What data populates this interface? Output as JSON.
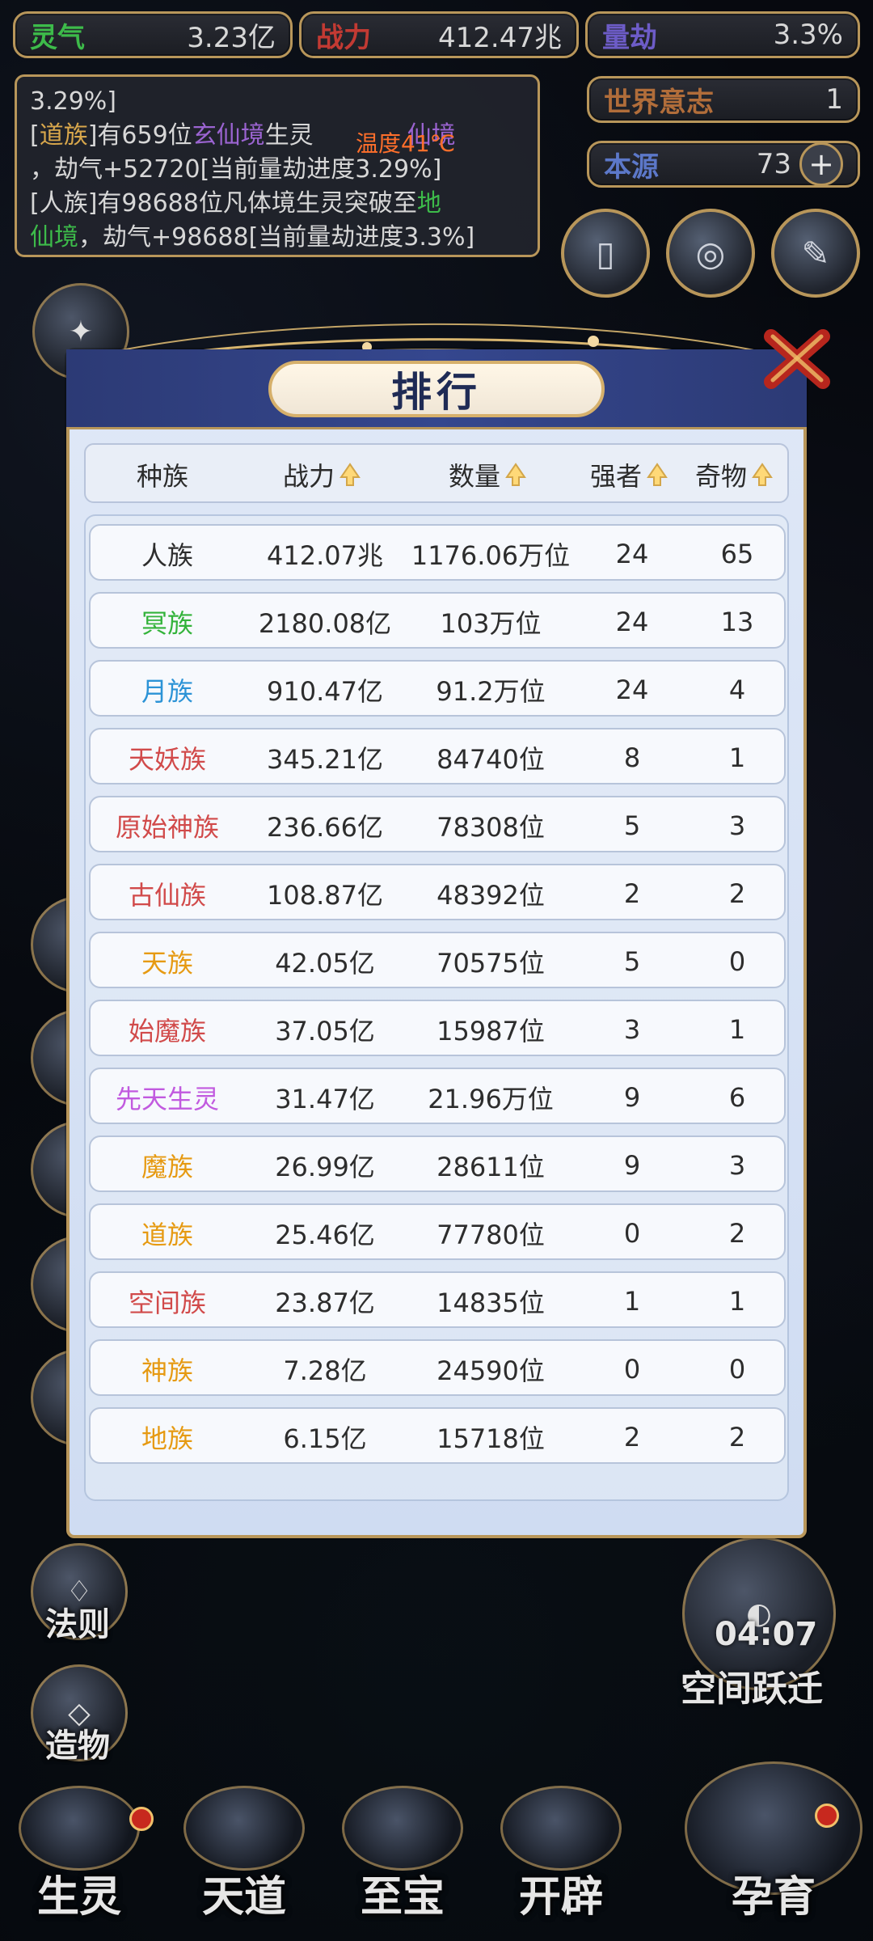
{
  "stats": {
    "lingqi": {
      "label": "灵气",
      "value": "3.23亿"
    },
    "zhanli": {
      "label": "战力",
      "value": "412.47兆"
    },
    "liangjie": {
      "label": "量劫",
      "value": "3.3%"
    },
    "shijie_yizhi": {
      "label": "世界意志",
      "value": "1"
    },
    "benyuan": {
      "label": "本源",
      "value": "73"
    }
  },
  "log": {
    "line1": "3.29%]",
    "line2_prefix": "[",
    "line2_race": "道族",
    "line2_a": "]有659位",
    "line2_realm": "玄仙境",
    "line2_b": "生灵",
    "line2_c": "仙境",
    "line3": "，劫气+52720[当前量劫进度3.29%]",
    "line4_a": "[人族]有98688位凡体境生灵突破至",
    "line4_realm1": "地",
    "line5_realm2": "仙境",
    "line5_b": "，劫气+98688[当前量劫进度3.3%]"
  },
  "temperature": "温度41℃",
  "modal": {
    "title": "排行",
    "headers": [
      "种族",
      "战力",
      "数量",
      "强者",
      "奇物"
    ],
    "rows": [
      {
        "race": "人族",
        "power": "412.07兆",
        "count": "1176.06万位",
        "strong": "24",
        "treasure": "65",
        "color": "#2d2d2d"
      },
      {
        "race": "冥族",
        "power": "2180.08亿",
        "count": "103万位",
        "strong": "24",
        "treasure": "13",
        "color": "#33b33a"
      },
      {
        "race": "月族",
        "power": "910.47亿",
        "count": "91.2万位",
        "strong": "24",
        "treasure": "4",
        "color": "#2c93d6"
      },
      {
        "race": "天妖族",
        "power": "345.21亿",
        "count": "84740位",
        "strong": "8",
        "treasure": "1",
        "color": "#d14a4a"
      },
      {
        "race": "原始神族",
        "power": "236.66亿",
        "count": "78308位",
        "strong": "5",
        "treasure": "3",
        "color": "#d14a4a"
      },
      {
        "race": "古仙族",
        "power": "108.87亿",
        "count": "48392位",
        "strong": "2",
        "treasure": "2",
        "color": "#d14a4a"
      },
      {
        "race": "天族",
        "power": "42.05亿",
        "count": "70575位",
        "strong": "5",
        "treasure": "0",
        "color": "#e69a12"
      },
      {
        "race": "始魔族",
        "power": "37.05亿",
        "count": "15987位",
        "strong": "3",
        "treasure": "1",
        "color": "#d14a4a"
      },
      {
        "race": "先天生灵",
        "power": "31.47亿",
        "count": "21.96万位",
        "strong": "9",
        "treasure": "6",
        "color": "#c15adf"
      },
      {
        "race": "魔族",
        "power": "26.99亿",
        "count": "28611位",
        "strong": "9",
        "treasure": "3",
        "color": "#e69a12"
      },
      {
        "race": "道族",
        "power": "25.46亿",
        "count": "77780位",
        "strong": "0",
        "treasure": "2",
        "color": "#e69a12"
      },
      {
        "race": "空间族",
        "power": "23.87亿",
        "count": "14835位",
        "strong": "1",
        "treasure": "1",
        "color": "#d14a4a"
      },
      {
        "race": "神族",
        "power": "7.28亿",
        "count": "24590位",
        "strong": "0",
        "treasure": "0",
        "color": "#e69a12"
      },
      {
        "race": "地族",
        "power": "6.15亿",
        "count": "15718位",
        "strong": "2",
        "treasure": "2",
        "color": "#e69a12"
      }
    ]
  },
  "left_menu": {
    "fa_ze": "法则",
    "zao_wu": "造物"
  },
  "right_timer": {
    "time": "04:07",
    "label": "空间跃迁"
  },
  "bottom_nav": {
    "sheng_ling": "生灵",
    "tian_dao": "天道",
    "zhi_bao": "至宝",
    "kai_pi": "开辟",
    "yun_yu": "孕育"
  }
}
